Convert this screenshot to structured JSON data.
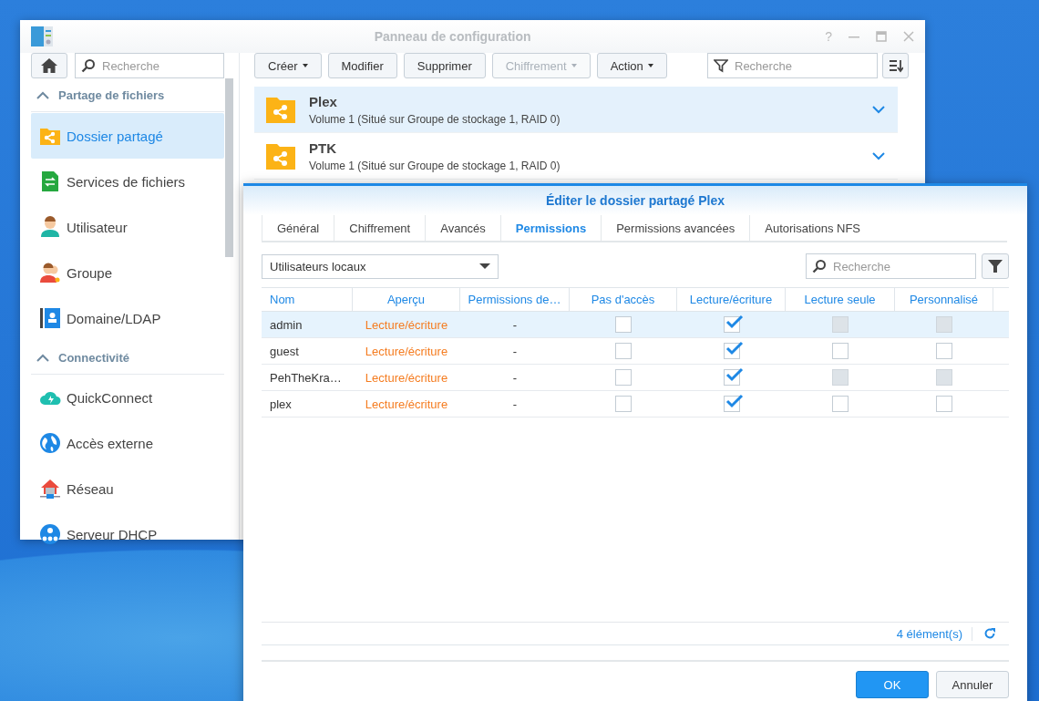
{
  "window": {
    "title": "Panneau de configuration",
    "help": "?"
  },
  "sidebar": {
    "search": {
      "placeholder": "Recherche"
    },
    "sections": [
      {
        "title": "Partage de fichiers",
        "expanded": true,
        "items": [
          {
            "label": "Dossier partagé",
            "selected": true
          },
          {
            "label": "Services de fichiers",
            "selected": false
          },
          {
            "label": "Utilisateur",
            "selected": false
          },
          {
            "label": "Groupe",
            "selected": false
          },
          {
            "label": "Domaine/LDAP",
            "selected": false
          }
        ]
      },
      {
        "title": "Connectivité",
        "expanded": true,
        "items": [
          {
            "label": "QuickConnect",
            "selected": false
          },
          {
            "label": "Accès externe",
            "selected": false
          },
          {
            "label": "Réseau",
            "selected": false
          },
          {
            "label": "Serveur DHCP",
            "selected": false
          }
        ]
      }
    ]
  },
  "toolbar": {
    "buttons": [
      {
        "label": "Créer",
        "menu": true,
        "disabled": false
      },
      {
        "label": "Modifier",
        "menu": false,
        "disabled": false
      },
      {
        "label": "Supprimer",
        "menu": false,
        "disabled": false
      },
      {
        "label": "Chiffrement",
        "menu": true,
        "disabled": true
      },
      {
        "label": "Action",
        "menu": true,
        "disabled": false
      }
    ],
    "search": {
      "placeholder": "Recherche"
    }
  },
  "shares": [
    {
      "name": "Plex",
      "location": "Volume 1 (Situé sur Groupe de stockage 1, RAID 0)",
      "selected": true
    },
    {
      "name": "PTK",
      "location": "Volume 1 (Situé sur Groupe de stockage 1, RAID 0)",
      "selected": false
    }
  ],
  "dialog": {
    "title": "Éditer le dossier partagé Plex",
    "tabs": [
      {
        "label": "Général",
        "selected": false
      },
      {
        "label": "Chiffrement",
        "selected": false
      },
      {
        "label": "Avancés",
        "selected": false
      },
      {
        "label": "Permissions",
        "selected": true
      },
      {
        "label": "Permissions avancées",
        "selected": false
      },
      {
        "label": "Autorisations NFS",
        "selected": false
      }
    ],
    "user_type": {
      "value": "Utilisateurs locaux"
    },
    "search": {
      "placeholder": "Recherche"
    },
    "columns": [
      "Nom",
      "Aperçu",
      "Permissions de…",
      "Pas d'accès",
      "Lecture/écriture",
      "Lecture seule",
      "Personnalisé"
    ],
    "rows": [
      {
        "name": "admin",
        "preview": "Lecture/écriture",
        "advanced": "-",
        "selected": true,
        "perms": [
          {
            "checked": false,
            "disabled": false
          },
          {
            "checked": true,
            "disabled": false
          },
          {
            "checked": false,
            "disabled": true
          },
          {
            "checked": false,
            "disabled": true
          }
        ]
      },
      {
        "name": "guest",
        "preview": "Lecture/écriture",
        "advanced": "-",
        "selected": false,
        "perms": [
          {
            "checked": false,
            "disabled": false
          },
          {
            "checked": true,
            "disabled": false
          },
          {
            "checked": false,
            "disabled": false
          },
          {
            "checked": false,
            "disabled": false
          }
        ]
      },
      {
        "name": "PehTheKra…",
        "preview": "Lecture/écriture",
        "advanced": "-",
        "selected": false,
        "perms": [
          {
            "checked": false,
            "disabled": false
          },
          {
            "checked": true,
            "disabled": false
          },
          {
            "checked": false,
            "disabled": true
          },
          {
            "checked": false,
            "disabled": true
          }
        ]
      },
      {
        "name": "plex",
        "preview": "Lecture/écriture",
        "advanced": "-",
        "selected": false,
        "perms": [
          {
            "checked": false,
            "disabled": false
          },
          {
            "checked": true,
            "disabled": false
          },
          {
            "checked": false,
            "disabled": false
          },
          {
            "checked": false,
            "disabled": false
          }
        ]
      }
    ],
    "count": "4 élément(s)",
    "buttons": [
      {
        "label": "OK",
        "kind": "primary"
      },
      {
        "label": "Annuler",
        "kind": "secondary"
      }
    ]
  }
}
